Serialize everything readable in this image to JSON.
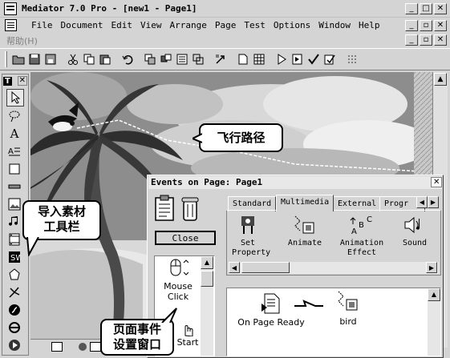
{
  "app": {
    "title": "Mediator 7.0 Pro - [new1 - Page1]",
    "help_menu_cn": "帮助",
    "help_menu_cn_key": "(H)",
    "menu": [
      "File",
      "Document",
      "Edit",
      "View",
      "Arrange",
      "Page",
      "Test",
      "Options",
      "Window",
      "Help"
    ]
  },
  "callouts": {
    "flight_path": "飞行路径",
    "import_toolbar_line1": "导入素材",
    "import_toolbar_line2": "工具栏",
    "page_events_line1": "页面事件",
    "page_events_line2": "设置窗口"
  },
  "events_panel": {
    "title": "Events on Page: Page1",
    "close_label": "Close",
    "tabs": [
      "Standard",
      "Multimedia",
      "External",
      "Progr"
    ],
    "active_tab": "Multimedia",
    "actions": [
      {
        "label_line1": "Set",
        "label_line2": "Property",
        "icon": "set-property-icon"
      },
      {
        "label_line1": "Animate",
        "label_line2": "",
        "icon": "animate-icon"
      },
      {
        "label_line1": "Animation",
        "label_line2": "Effect",
        "icon": "animation-effect-icon"
      },
      {
        "label_line1": "Sound",
        "label_line2": "",
        "icon": "sound-icon"
      }
    ],
    "events": [
      {
        "label_line1": "Mouse",
        "label_line2": "Click"
      },
      {
        "label_line1": "",
        "label_line2": "Start"
      }
    ],
    "timeline": [
      {
        "label": "On Page Ready",
        "icon": "page-ready-icon"
      },
      {
        "label": "bird",
        "icon": "animate-icon"
      }
    ]
  },
  "tools_panel": {
    "title_glyph": "T"
  }
}
